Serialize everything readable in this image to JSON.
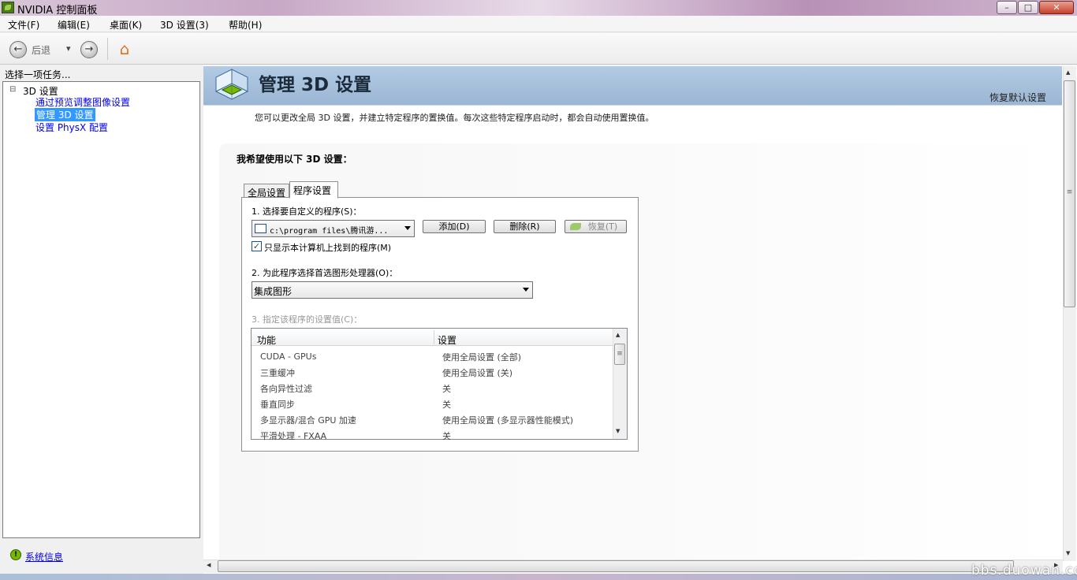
{
  "window": {
    "title": "NVIDIA 控制面板",
    "min_glyph": "–",
    "max_glyph": "□",
    "close_glyph": "✕"
  },
  "menu": [
    "文件(F)",
    "编辑(E)",
    "桌面(K)",
    "3D 设置(3)",
    "帮助(H)"
  ],
  "toolbar": {
    "back_label": "后退",
    "back_glyph": "←",
    "forward_glyph": "→",
    "dropdown_glyph": "▾",
    "home_glyph": "⌂"
  },
  "left_panel": {
    "task_prompt": "选择一项任务...",
    "tree_root": "3D 设置",
    "tree_expander": "⊟",
    "tree_items": [
      "通过预览调整图像设置",
      "管理 3D 设置",
      "设置 PhysX 配置"
    ],
    "selected_index": 1,
    "system_info_link": "系统信息",
    "system_info_glyph": "!"
  },
  "main": {
    "page_title": "管理 3D 设置",
    "restore_defaults": "恢复默认设置",
    "description": "您可以更改全局 3D 设置，并建立特定程序的置换值。每次这些特定程序启动时，都会自动使用置换值。",
    "section_heading": "我希望使用以下 3D 设置：",
    "tabs": [
      "全局设置",
      "程序设置"
    ],
    "active_tab": "程序设置",
    "step1_label": "1. 选择要自定义的程序(S)：",
    "program_selected": "c:\\program files\\腾讯游...",
    "add_button": "添加(D)",
    "delete_button": "删除(R)",
    "restore_button": "恢复(T)",
    "only_found_checkbox": "只显示本计算机上找到的程序(M)",
    "only_found_checked": true,
    "check_glyph": "✓",
    "step2_label": "2. 为此程序选择首选图形处理器(O)：",
    "gpu_selected": "集成图形",
    "step3_label": "3. 指定该程序的设置值(C)：",
    "grid_headers": [
      "功能",
      "设置"
    ],
    "grid_rows": [
      {
        "feature": "CUDA - GPUs",
        "setting": "使用全局设置 (全部)"
      },
      {
        "feature": "三重缓冲",
        "setting": "使用全局设置 (关)"
      },
      {
        "feature": "各向异性过滤",
        "setting": "关"
      },
      {
        "feature": "垂直同步",
        "setting": "关"
      },
      {
        "feature": "多显示器/混合 GPU 加速",
        "setting": "使用全局设置 (多显示器性能模式)"
      },
      {
        "feature": "平滑处理 - FXAA",
        "setting": "关"
      }
    ],
    "scroll_up_glyph": "▲",
    "scroll_down_glyph": "▼",
    "scroll_left_glyph": "◀",
    "scroll_right_glyph": "▶",
    "scroll_grip_glyph": "≡"
  },
  "watermark": "bbs.duowan.com",
  "colors": {
    "selection": "#3399ff",
    "link": "#0000ee",
    "banner": "#a9c2dc",
    "nvidia_green": "#76b900"
  }
}
